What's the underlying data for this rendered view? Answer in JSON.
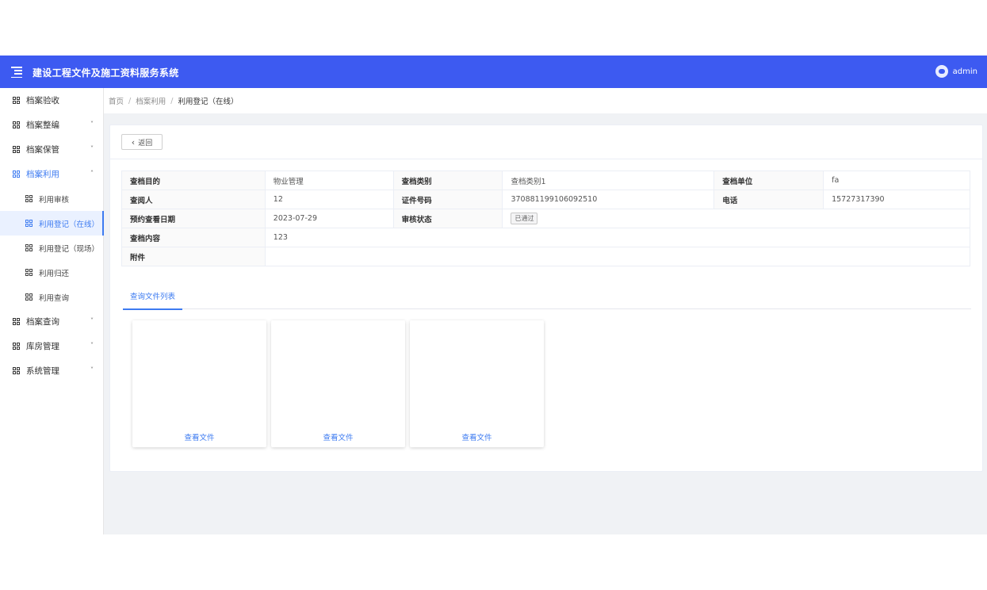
{
  "header": {
    "title": "建设工程文件及施工资料服务系统",
    "username": "admin",
    "accent_color": "#3d5af1"
  },
  "sidebar": {
    "items": [
      {
        "label": "档案验收",
        "icon": "grid-icon"
      },
      {
        "label": "档案整编",
        "icon": "grid-icon",
        "chevron": "˅"
      },
      {
        "label": "档案保管",
        "icon": "grid-icon",
        "chevron": "˅"
      },
      {
        "label": "档案利用",
        "icon": "grid-icon",
        "chevron": "˄"
      },
      {
        "label": "利用审核",
        "icon": "grid-icon"
      },
      {
        "label": "利用登记（在线）",
        "icon": "grid-icon"
      },
      {
        "label": "利用登记（现场）",
        "icon": "grid-icon"
      },
      {
        "label": "利用归还",
        "icon": "grid-icon"
      },
      {
        "label": "利用查询",
        "icon": "grid-icon"
      },
      {
        "label": "档案查询",
        "icon": "grid-icon",
        "chevron": "˅"
      },
      {
        "label": "库房管理",
        "icon": "grid-icon",
        "chevron": "˅"
      },
      {
        "label": "系统管理",
        "icon": "grid-icon",
        "chevron": "˅"
      }
    ]
  },
  "breadcrumb": {
    "items": [
      "首页",
      "档案利用",
      "利用登记（在线）"
    ],
    "separator": "/"
  },
  "detail": {
    "back_label": "返回",
    "rows": [
      {
        "l1": "查档目的",
        "v1": "物业管理",
        "l2": "查档类别",
        "v2": "查档类别1",
        "l3": "查档单位",
        "v3": "fa"
      },
      {
        "l1": "查阅人",
        "v1": "12",
        "l2": "证件号码",
        "v2": "370881199106092510",
        "l3": "电话",
        "v3": "15727317390"
      },
      {
        "l1": "预约查看日期",
        "v1": "2023-07-29",
        "l2": "审核状态",
        "status": "已通过"
      },
      {
        "l1": "查档内容",
        "v1": "123"
      },
      {
        "l1": "附件",
        "v1": ""
      }
    ]
  },
  "tabs": {
    "file_list": "查询文件列表"
  },
  "files": [
    {
      "link": "查看文件"
    },
    {
      "link": "查看文件"
    },
    {
      "link": "查看文件"
    }
  ]
}
